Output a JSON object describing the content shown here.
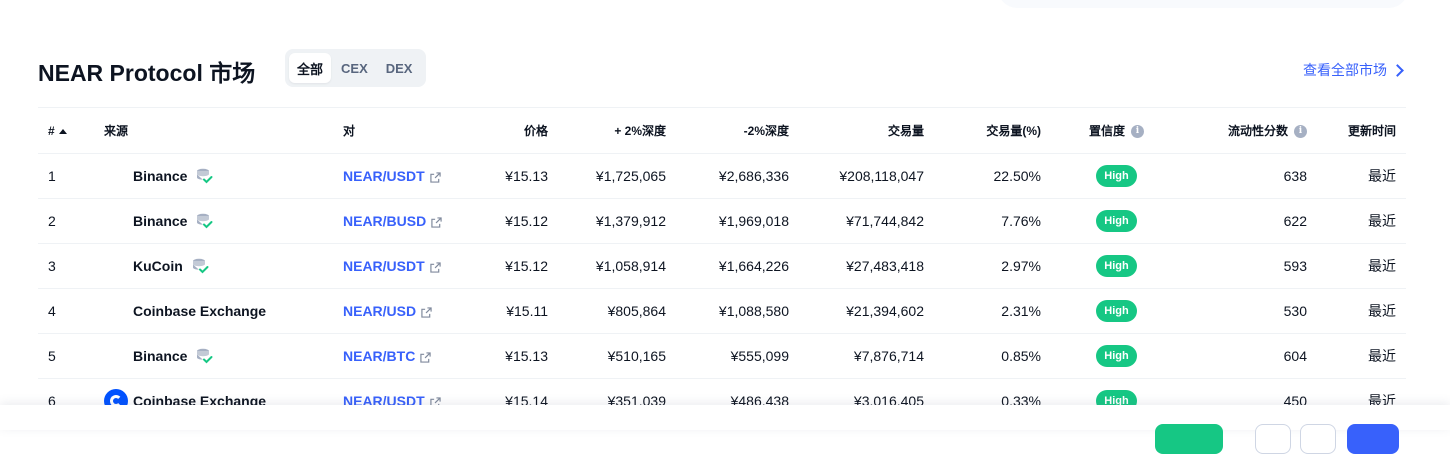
{
  "header": {
    "title": "NEAR Protocol 市场",
    "tabs": [
      "全部",
      "CEX",
      "DEX"
    ],
    "active_tab": "全部",
    "view_all": "查看全部市场"
  },
  "table": {
    "columns": {
      "rank": "#",
      "source": "来源",
      "pair": "对",
      "price": "价格",
      "depth_plus": "+ 2%深度",
      "depth_minus": "-2%深度",
      "volume": "交易量",
      "volume_pct": "交易量(%)",
      "confidence": "置信度",
      "liquidity": "流动性分数",
      "updated": "更新时间"
    },
    "rows": [
      {
        "rank": "1",
        "source": "Binance",
        "proof": true,
        "logo": "",
        "pair": "NEAR/USDT",
        "price": "¥15.13",
        "depth_plus": "¥1,725,065",
        "depth_minus": "¥2,686,336",
        "volume": "¥208,118,047",
        "volume_pct": "22.50%",
        "confidence": "High",
        "liquidity": "638",
        "updated": "最近"
      },
      {
        "rank": "2",
        "source": "Binance",
        "proof": true,
        "logo": "",
        "pair": "NEAR/BUSD",
        "price": "¥15.12",
        "depth_plus": "¥1,379,912",
        "depth_minus": "¥1,969,018",
        "volume": "¥71,744,842",
        "volume_pct": "7.76%",
        "confidence": "High",
        "liquidity": "622",
        "updated": "最近"
      },
      {
        "rank": "3",
        "source": "KuCoin",
        "proof": true,
        "logo": "",
        "pair": "NEAR/USDT",
        "price": "¥15.12",
        "depth_plus": "¥1,058,914",
        "depth_minus": "¥1,664,226",
        "volume": "¥27,483,418",
        "volume_pct": "2.97%",
        "confidence": "High",
        "liquidity": "593",
        "updated": "最近"
      },
      {
        "rank": "4",
        "source": "Coinbase Exchange",
        "proof": false,
        "logo": "",
        "pair": "NEAR/USD",
        "price": "¥15.11",
        "depth_plus": "¥805,864",
        "depth_minus": "¥1,088,580",
        "volume": "¥21,394,602",
        "volume_pct": "2.31%",
        "confidence": "High",
        "liquidity": "530",
        "updated": "最近"
      },
      {
        "rank": "5",
        "source": "Binance",
        "proof": true,
        "logo": "",
        "pair": "NEAR/BTC",
        "price": "¥15.13",
        "depth_plus": "¥510,165",
        "depth_minus": "¥555,099",
        "volume": "¥7,876,714",
        "volume_pct": "0.85%",
        "confidence": "High",
        "liquidity": "604",
        "updated": "最近"
      },
      {
        "rank": "6",
        "source": "Coinbase Exchange",
        "proof": false,
        "logo": "coinbase-logo",
        "pair": "NEAR/USDT",
        "price": "¥15.14",
        "depth_plus": "¥351,039",
        "depth_minus": "¥486,438",
        "volume": "¥3,016,405",
        "volume_pct": "0.33%",
        "confidence": "High",
        "liquidity": "450",
        "updated": "最近"
      }
    ]
  },
  "icons": {
    "sort": "sort-ascending-icon",
    "info": "info-icon",
    "external_link": "external-link-icon",
    "proof_of_reserves": "proof-of-reserves-icon",
    "chevron": "chevron-right-icon"
  },
  "colors": {
    "accent": "#3861fb",
    "high_badge": "#16c784",
    "text": "#0d1421",
    "muted": "#58667e"
  }
}
